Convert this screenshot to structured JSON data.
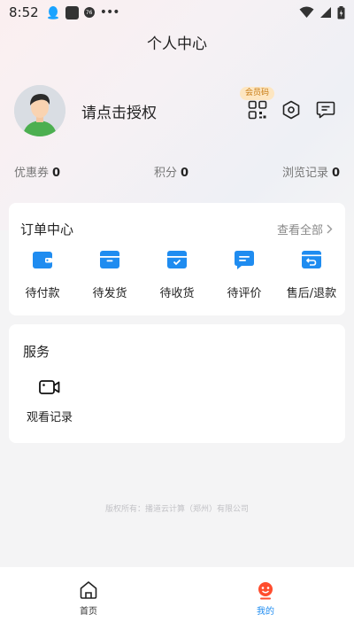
{
  "status_bar": {
    "time": "8:52",
    "notification_icons": [
      "qq-icon",
      "app-square-icon",
      "badge-icon",
      "more-dots-icon"
    ],
    "badge_text": "76",
    "more_dots": "•••",
    "right_icons": [
      "wifi-icon",
      "signal-icon",
      "battery-icon"
    ]
  },
  "header": {
    "title": "个人中心"
  },
  "profile": {
    "login_text": "请点击授权",
    "member_badge": "会员码",
    "icons": [
      "qr-code-icon",
      "settings-icon",
      "message-icon"
    ]
  },
  "stats": [
    {
      "label": "优惠券",
      "value": "0"
    },
    {
      "label": "积分",
      "value": "0"
    },
    {
      "label": "浏览记录",
      "value": "0"
    }
  ],
  "orders": {
    "title": "订单中心",
    "view_all": "查看全部",
    "items": [
      {
        "label": "待付款",
        "icon": "wallet-icon"
      },
      {
        "label": "待发货",
        "icon": "box-icon"
      },
      {
        "label": "待收货",
        "icon": "box-check-icon"
      },
      {
        "label": "待评价",
        "icon": "comment-icon"
      },
      {
        "label": "售后/退款",
        "icon": "return-icon"
      }
    ]
  },
  "services": {
    "title": "服务",
    "items": [
      {
        "label": "观看记录",
        "icon": "video-camera-icon"
      }
    ]
  },
  "footer": {
    "copyright": "版权所有：播道云计算（郑州）有限公司"
  },
  "tabbar": {
    "tabs": [
      {
        "label": "首页",
        "icon": "home-icon",
        "active": false
      },
      {
        "label": "我的",
        "icon": "profile-icon",
        "active": true
      }
    ]
  },
  "colors": {
    "accent_blue": "#1f8cf0",
    "tab_active": "#1f8cf0",
    "badge_bg": "#fde6c1",
    "profile_red": "#ff4d2e"
  }
}
